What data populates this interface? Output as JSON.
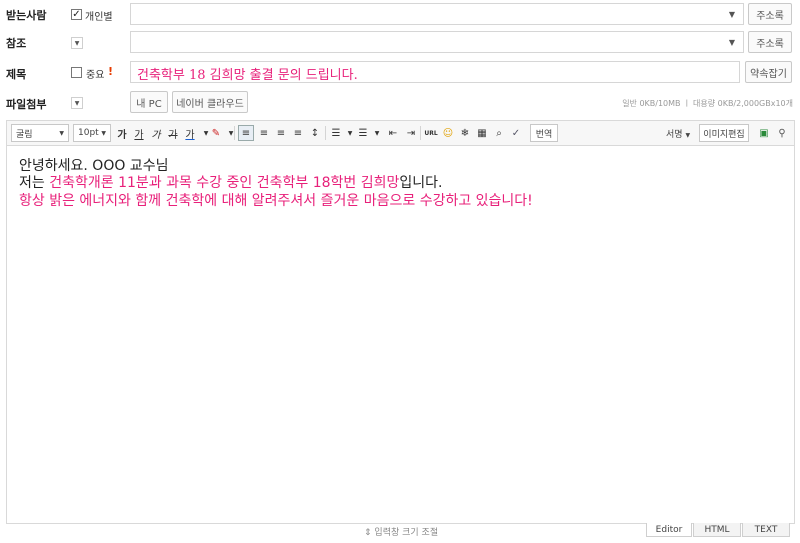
{
  "recipients": {
    "label": "받는사람",
    "individual_checkbox_label": "개인별",
    "address_book_label": "주소록"
  },
  "cc": {
    "label": "참조",
    "address_book_label": "주소록"
  },
  "subject": {
    "label": "제목",
    "important_label": "중요",
    "important_mark": "!",
    "value": "건축학부 18 김희망 출결 문의 드립니다.",
    "appointment_button_label": "약속잡기"
  },
  "attachments": {
    "label": "파일첨부",
    "my_pc_label": "내 PC",
    "naver_cloud_label": "네이버 클라우드",
    "quota_text": "일반 0KB/10MB ㅣ 대용량 0KB/2,000GBx10개"
  },
  "toolbar": {
    "font_family": "굴림",
    "font_size": "10pt",
    "translate_label": "번역",
    "signature_label": "서명",
    "image_edit_label": "이미지편집",
    "url_label": "URL"
  },
  "body": {
    "line1": "안녕하세요. OOO 교수님",
    "line2_pre": "저는 ",
    "line2_highlight": "건축학개론 11분과 과목 수강 중인 건축학부 18학번 김희망",
    "line2_post": "입니다.",
    "line3": "항상 밝은 에너지와 함께 건축학에 대해 알려주셔서 즐거운 마음으로 수강하고 있습니다!"
  },
  "footer": {
    "resize_label": "입력창 크기 조절",
    "tabs": [
      "Editor",
      "HTML",
      "TEXT"
    ]
  },
  "colors": {
    "highlight": "#e8207a"
  }
}
